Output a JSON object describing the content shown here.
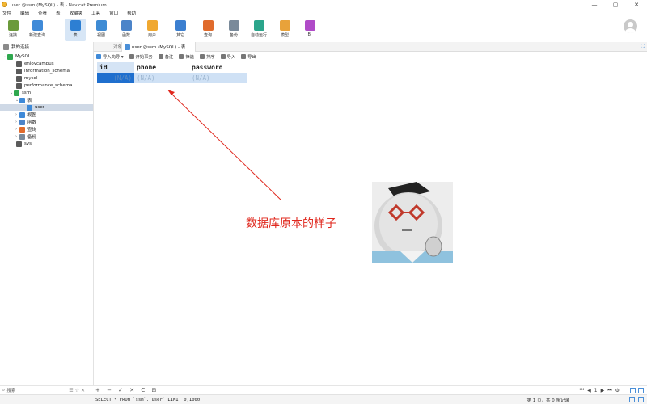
{
  "window": {
    "title": "user @ssm (MySQL) - 表 - Navicat Premium",
    "controls": [
      "—",
      "▢",
      "✕"
    ]
  },
  "menu": [
    "文件",
    "编辑",
    "查看",
    "表",
    "收藏夹",
    "工具",
    "窗口",
    "帮助"
  ],
  "toolbar": [
    {
      "label": "连接",
      "color": "#6b9a3b"
    },
    {
      "label": "新建查询",
      "color": "#3f8ad8"
    },
    {
      "label": "表",
      "color": "#2d7fd3"
    },
    {
      "label": "视图",
      "color": "#3e8bd4"
    },
    {
      "label": "函数",
      "color": "#4b84c9"
    },
    {
      "label": "用户",
      "color": "#f0a830"
    },
    {
      "label": "其它",
      "color": "#3b7fd0"
    },
    {
      "label": "查询",
      "color": "#e06b2c"
    },
    {
      "label": "备份",
      "color": "#7a8a9a"
    },
    {
      "label": "自动运行",
      "color": "#2ba58b"
    },
    {
      "label": "模型",
      "color": "#e8a23a"
    },
    {
      "label": "BI",
      "color": "#b04bc8"
    }
  ],
  "sidebar": {
    "items": [
      {
        "label": "我的连接",
        "arrow": "",
        "color": "#8a8a8a"
      },
      {
        "label": "MySQL",
        "arrow": "⌄",
        "color": "#2fa84f"
      },
      {
        "label": "enjoycampus",
        "arrow": "",
        "color": "#5b5b5b"
      },
      {
        "label": "information_schema",
        "arrow": "",
        "color": "#5b5b5b"
      },
      {
        "label": "mysql",
        "arrow": "",
        "color": "#5b5b5b"
      },
      {
        "label": "performance_schema",
        "arrow": "",
        "color": "#5b5b5b"
      },
      {
        "label": "ssm",
        "arrow": "⌄",
        "color": "#2fa84f"
      },
      {
        "label": "表",
        "arrow": "⌄",
        "color": "#3f8ad8"
      },
      {
        "label": "user",
        "arrow": "",
        "color": "#3f8ad8"
      },
      {
        "label": "视图",
        "arrow": "›",
        "color": "#3f8ad8"
      },
      {
        "label": "函数",
        "arrow": "›",
        "color": "#4b84c9"
      },
      {
        "label": "查询",
        "arrow": "›",
        "color": "#e06b2c"
      },
      {
        "label": "备份",
        "arrow": "›",
        "color": "#7a8a9a"
      },
      {
        "label": "sys",
        "arrow": "",
        "color": "#5b5b5b"
      }
    ],
    "search_label": "搜索"
  },
  "tabs": {
    "objects": "对象",
    "active": "user @ssm (MySQL) - 表"
  },
  "subtoolbar": [
    {
      "label": "导入向导 ▾",
      "color": "#3f8ad8"
    },
    {
      "label": "开始事务",
      "color": "#777777"
    },
    {
      "label": "备注",
      "color": "#777777"
    },
    {
      "label": "筛选",
      "color": "#777777"
    },
    {
      "label": "排序",
      "color": "#777777"
    },
    {
      "label": "导入",
      "color": "#777777"
    },
    {
      "label": "导出",
      "color": "#777777"
    }
  ],
  "grid": {
    "columns": [
      "id",
      "phone",
      "password"
    ],
    "rows": [
      [
        "(N/A)",
        "(N/A)",
        "(N/A)"
      ]
    ]
  },
  "annotation": "数据库原本的样子",
  "bottom_bar": {
    "left_icons": "+ − ✓ ✕ C ⊟",
    "pager": [
      "⏮",
      "◀",
      "1",
      "▶",
      "⏭",
      "⚙"
    ]
  },
  "status": {
    "sql": "SELECT * FROM `ssm`.`user` LIMIT 0,1000",
    "records": "第 1 页，共 0 条记录"
  }
}
